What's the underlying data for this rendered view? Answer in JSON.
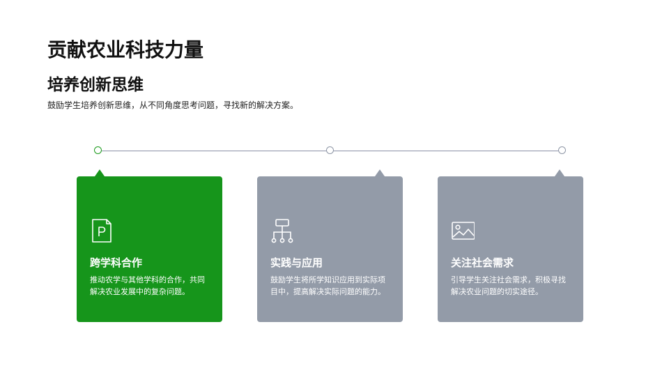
{
  "header": {
    "title": "贡献农业科技力量",
    "subtitle": "培养创新思维",
    "description": "鼓励学生培养创新思维，从不同角度思考问题，寻找新的解决方案。"
  },
  "cards": [
    {
      "icon": "document-p-icon",
      "title": "跨学科合作",
      "text": "推动农学与其他学科的合作，共同解决农业发展中的复杂问题。",
      "color": "#16951b"
    },
    {
      "icon": "hierarchy-diagram-icon",
      "title": "实践与应用",
      "text": "鼓励学生将所学知识应用到实际项目中，提高解决实际问题的能力。",
      "color": "#939ba8"
    },
    {
      "icon": "image-icon",
      "title": "关注社会需求",
      "text": "引导学生关注社会需求，积极寻找解决农业问题的切实途径。",
      "color": "#939ba8"
    }
  ],
  "colors": {
    "accent": "#16951b",
    "neutral": "#939ba8",
    "line": "#8a90a6"
  }
}
